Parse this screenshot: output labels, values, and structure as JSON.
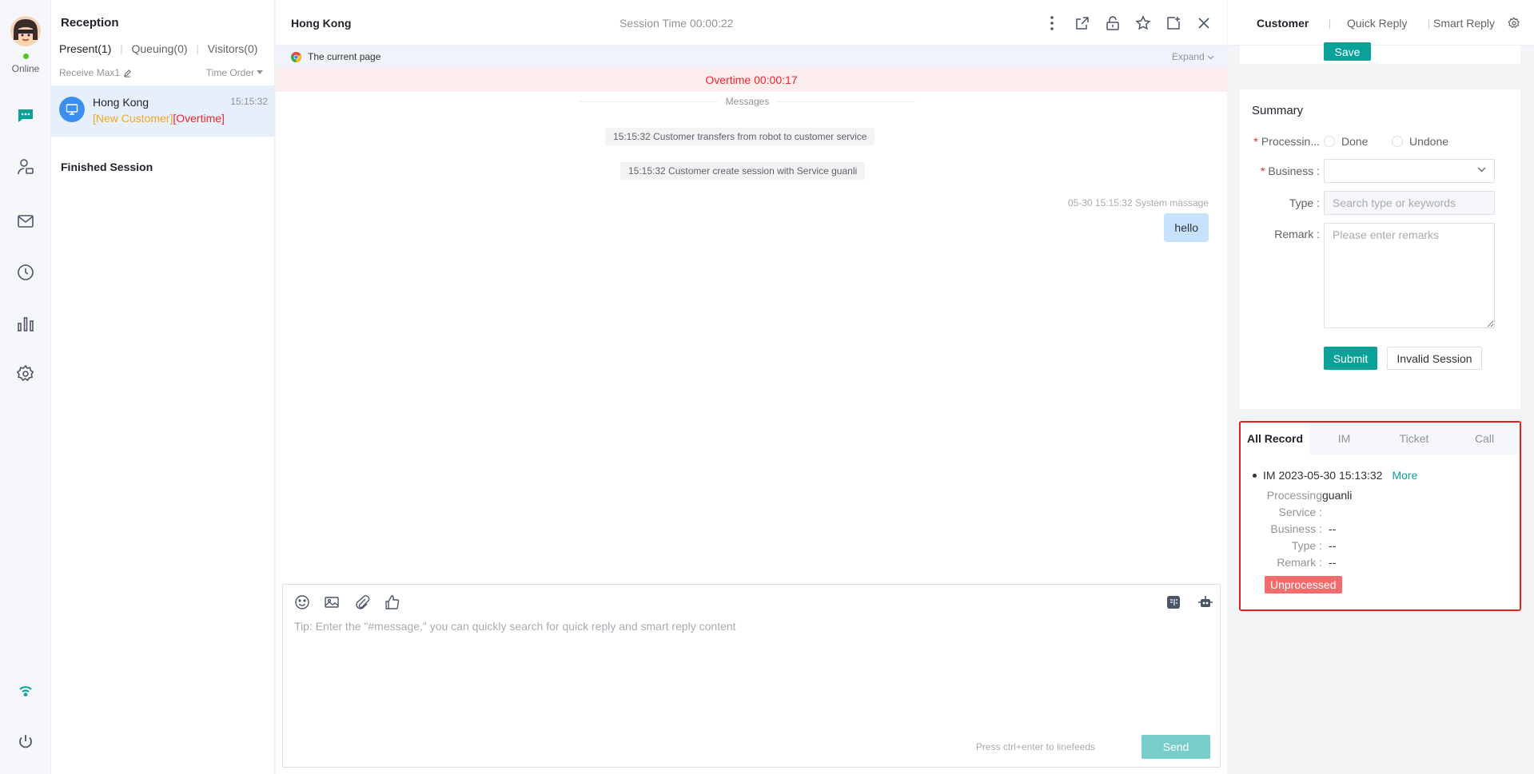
{
  "agent": {
    "status": "Online"
  },
  "sessions": {
    "title": "Reception",
    "tabs": [
      {
        "label": "Present(1)"
      },
      {
        "label": "Queuing(0)"
      },
      {
        "label": "Visitors(0)"
      }
    ],
    "receive_max": "Receive Max1",
    "order_label": "Time Order",
    "items": [
      {
        "name": "Hong Kong",
        "time": "15:15:32",
        "tag_new": "[New Customer]",
        "tag_overtime": "[Overtime]"
      }
    ],
    "finished_title": "Finished Session"
  },
  "chat": {
    "name": "Hong Kong",
    "session_time": "Session Time 00:00:22",
    "current_page": "The current page",
    "expand": "Expand",
    "overtime": "Overtime 00:00:17",
    "messages_divider": "Messages",
    "system_messages": [
      "15:15:32 Customer transfers from robot to customer service",
      "15:15:32 Customer create session with Service guanli"
    ],
    "message_meta": "05-30 15:15:32   System massage",
    "message_text": "hello",
    "composer_placeholder": "Tip: Enter the \"#message,\" you can quickly search for quick reply and smart reply content",
    "composer_hint": "Press ctrl+enter to linefeeds",
    "send_label": "Send"
  },
  "right": {
    "tabs": [
      {
        "label": "Customer"
      },
      {
        "label": "Quick Reply"
      },
      {
        "label": "Smart Reply"
      }
    ],
    "save_label": "Save",
    "summary": {
      "title": "Summary",
      "processing_label": "Processin...",
      "radio_done": "Done",
      "radio_undone": "Undone",
      "business_label": "Business",
      "type_label": "Type",
      "type_placeholder": "Search type or keywords",
      "remark_label": "Remark",
      "remark_placeholder": "Please enter remarks",
      "submit_label": "Submit",
      "invalid_label": "Invalid Session"
    },
    "record": {
      "tabs": [
        {
          "label": "All Record"
        },
        {
          "label": "IM"
        },
        {
          "label": "Ticket"
        },
        {
          "label": "Call"
        }
      ],
      "entry_title": "IM 2023-05-30 15:13:32",
      "more_label": "More",
      "processing_service_label_1": "Processing",
      "processing_service_label_2": "Service",
      "processing_service_value": "guanli",
      "business_label": "Business",
      "business_value": "--",
      "type_label": "Type",
      "type_value": "--",
      "remark_label": "Remark",
      "remark_value": "--",
      "status_badge": "Unprocessed"
    }
  },
  "colors": {
    "accent": "#0aa198",
    "overtime": "#f5222d",
    "new_customer": "#f5a623",
    "highlight_border": "#e0201b"
  }
}
